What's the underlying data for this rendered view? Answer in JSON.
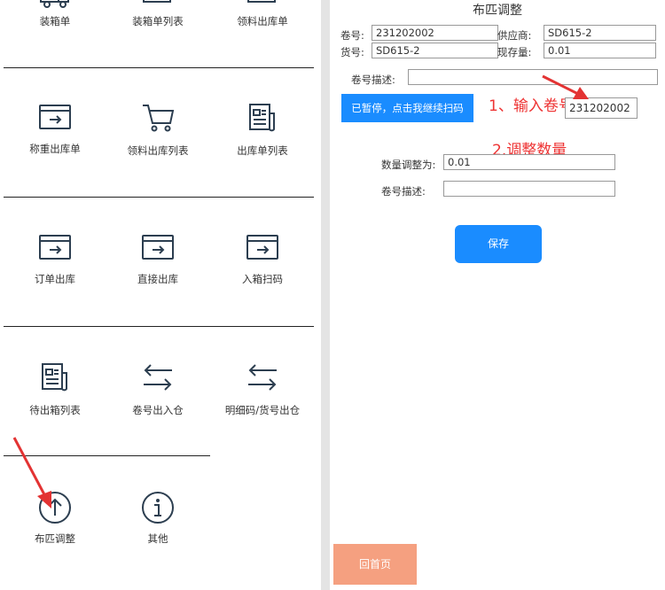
{
  "menu": {
    "tiles": [
      {
        "label": "装箱单",
        "icon": "truck-icon"
      },
      {
        "label": "装箱单列表",
        "icon": "truck-list-icon"
      },
      {
        "label": "领料出库单",
        "icon": "truck-out-icon"
      },
      {
        "label": "称重出库单",
        "icon": "export-box-icon"
      },
      {
        "label": "领料出库列表",
        "icon": "cart-icon"
      },
      {
        "label": "出库单列表",
        "icon": "document-list-icon"
      },
      {
        "label": "订单出库",
        "icon": "export-box-icon"
      },
      {
        "label": "直接出库",
        "icon": "export-box-icon"
      },
      {
        "label": "入箱扫码",
        "icon": "export-box-icon"
      },
      {
        "label": "待出箱列表",
        "icon": "document-list-icon"
      },
      {
        "label": "卷号出入仓",
        "icon": "swap-arrows-icon"
      },
      {
        "label": "明细码/货号出仓",
        "icon": "swap-arrows-icon"
      },
      {
        "label": "布匹调整",
        "icon": "arrow-up-circle-icon"
      },
      {
        "label": "其他",
        "icon": "info-circle-icon"
      }
    ]
  },
  "form": {
    "title": "布匹调整",
    "roll_no_label": "卷号:",
    "roll_no_value": "231202002",
    "supplier_label": "供应商:",
    "supplier_value": "SD615-2",
    "item_no_label": "货号:",
    "item_no_value": "SD615-2",
    "stock_label": "现存量:",
    "stock_value": "0.01",
    "roll_desc_label": "卷号描述:",
    "roll_desc_value": "",
    "scan_button": "已暂停，点击我继续扫码",
    "scan_input_value": "231202002",
    "adjust_qty_label": "数量调整为:",
    "adjust_qty_value": "0.01",
    "roll_desc2_label": "卷号描述:",
    "roll_desc2_value": "",
    "save_button": "保存",
    "home_button": "回首页"
  },
  "annotations": {
    "step1": "1、输入卷号",
    "step2": "2.调整数量",
    "color": "#e33333"
  },
  "colors": {
    "primary": "#1a8cff",
    "home_button": "#f5a080",
    "icon": "#2c3e50"
  }
}
